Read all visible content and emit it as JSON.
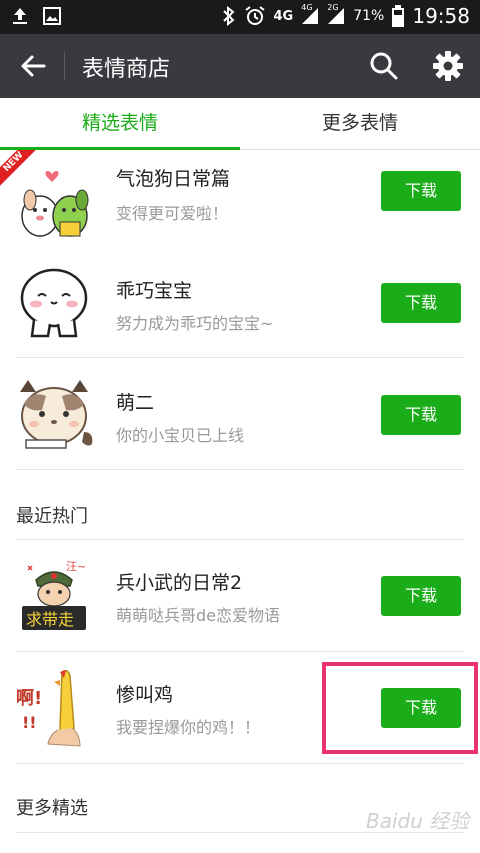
{
  "status_bar": {
    "network_4g_label": "4G",
    "network_4g_small": "4G",
    "network_2g_small": "2G",
    "battery_percent": "71%",
    "time": "19:58"
  },
  "app_bar": {
    "title": "表情商店"
  },
  "tabs": [
    {
      "label": "精选表情",
      "active": true
    },
    {
      "label": "更多表情",
      "active": false
    }
  ],
  "featured_badge": "NEW",
  "featured": [
    {
      "name": "气泡狗日常篇",
      "desc": "变得更可爱啦！",
      "button": "下载"
    },
    {
      "name": "乖巧宝宝",
      "desc": "努力成为乖巧的宝宝~",
      "button": "下载"
    },
    {
      "name": "萌二",
      "desc": "你的小宝贝已上线",
      "button": "下载"
    }
  ],
  "section_recent": "最近热门",
  "recent": [
    {
      "name": "兵小武的日常2",
      "desc": "萌萌哒兵哥de恋爱物语",
      "button": "下载",
      "thumb_text": "求带走",
      "thumb_small": "汪~"
    },
    {
      "name": "惨叫鸡",
      "desc": "我要捏爆你的鸡！！",
      "button": "下载",
      "thumb_text": "啊!",
      "thumb_small": "!!"
    }
  ],
  "section_more": "更多精选",
  "watermark": "Baidu 经验",
  "colors": {
    "accent": "#1aad19",
    "appbar": "#393a3f",
    "highlight": "#e8336d"
  }
}
